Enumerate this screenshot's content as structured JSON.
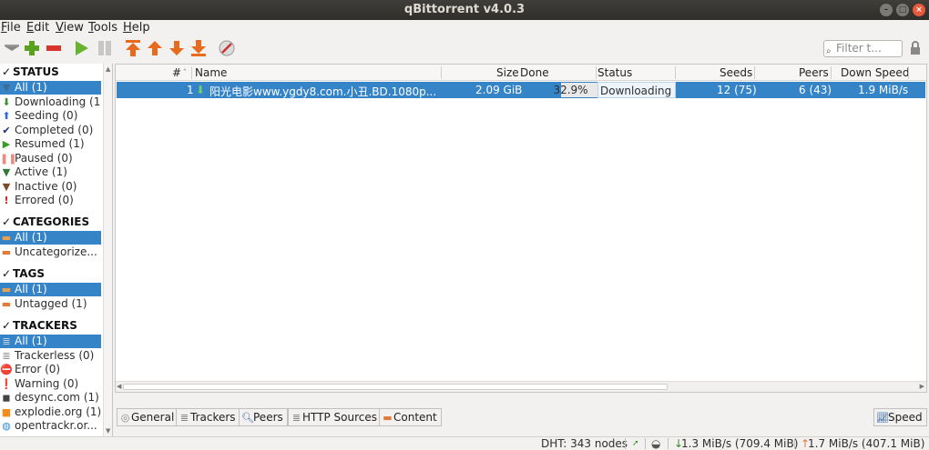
{
  "window": {
    "title": "qBittorrent v4.0.3"
  },
  "menu": [
    {
      "accel": "F",
      "rest": "ile"
    },
    {
      "accel": "E",
      "rest": "dit"
    },
    {
      "accel": "V",
      "rest": "iew"
    },
    {
      "accel": "T",
      "rest": "ools"
    },
    {
      "accel": "H",
      "rest": "elp"
    }
  ],
  "toolbar": {
    "filter_placeholder": "Filter t..."
  },
  "sidebar": {
    "status": {
      "title": "STATUS",
      "items": [
        {
          "label": "All (1)",
          "icon": "filter-icon"
        },
        {
          "label": "Downloading (1)",
          "icon": "arrow-down-icon"
        },
        {
          "label": "Seeding (0)",
          "icon": "arrow-up-icon"
        },
        {
          "label": "Completed (0)",
          "icon": "checkmark-icon"
        },
        {
          "label": "Resumed (1)",
          "icon": "play-icon"
        },
        {
          "label": "Paused (0)",
          "icon": "pause-icon"
        },
        {
          "label": "Active (1)",
          "icon": "filter-icon"
        },
        {
          "label": "Inactive (0)",
          "icon": "filter-icon"
        },
        {
          "label": "Errored (0)",
          "icon": "exclamation-icon"
        }
      ]
    },
    "categories": {
      "title": "CATEGORIES",
      "items": [
        {
          "label": "All (1)",
          "icon": "folder-icon"
        },
        {
          "label": "Uncategorize...",
          "icon": "folder-icon"
        }
      ]
    },
    "tags": {
      "title": "TAGS",
      "items": [
        {
          "label": "All (1)",
          "icon": "folder-icon"
        },
        {
          "label": "Untagged (1)",
          "icon": "folder-icon"
        }
      ]
    },
    "trackers": {
      "title": "TRACKERS",
      "items": [
        {
          "label": "All (1)",
          "icon": "server-icon"
        },
        {
          "label": "Trackerless (0)",
          "icon": "server-icon"
        },
        {
          "label": "Error (0)",
          "icon": "error-icon"
        },
        {
          "label": "Warning (0)",
          "icon": "warning-icon"
        },
        {
          "label": "desync.com (1)",
          "icon": "cube-icon"
        },
        {
          "label": "explodie.org (1)",
          "icon": "square-icon"
        },
        {
          "label": "opentrackr.or...",
          "icon": "globe-icon"
        }
      ]
    }
  },
  "table": {
    "headers": {
      "num": "#",
      "name": "Name",
      "size": "Size",
      "done": "Done",
      "status": "Status",
      "seeds": "Seeds",
      "peers": "Peers",
      "down_speed": "Down Speed"
    },
    "rows": [
      {
        "num": "1",
        "name": "阳光电影www.ygdy8.com.小丑.BD.1080p....",
        "size": "2.09 GiB",
        "done": "32.9%",
        "progress": 0.329,
        "status": "Downloading",
        "seeds": "12 (75)",
        "peers": "6 (43)",
        "down_speed": "1.9 MiB/s"
      }
    ]
  },
  "tabs": {
    "general": "General",
    "trackers": "Trackers",
    "peers": "Peers",
    "http_sources": "HTTP Sources",
    "content": "Content",
    "speed": "Speed"
  },
  "statusbar": {
    "dht": "DHT: 343 nodes",
    "down": "1.3 MiB/s (709.4 MiB)",
    "up": "1.7 MiB/s (407.1 MiB)"
  },
  "colors": {
    "selection": "#3584c8",
    "titlebar": "#3c3b37",
    "close_button": "#e9593b"
  }
}
